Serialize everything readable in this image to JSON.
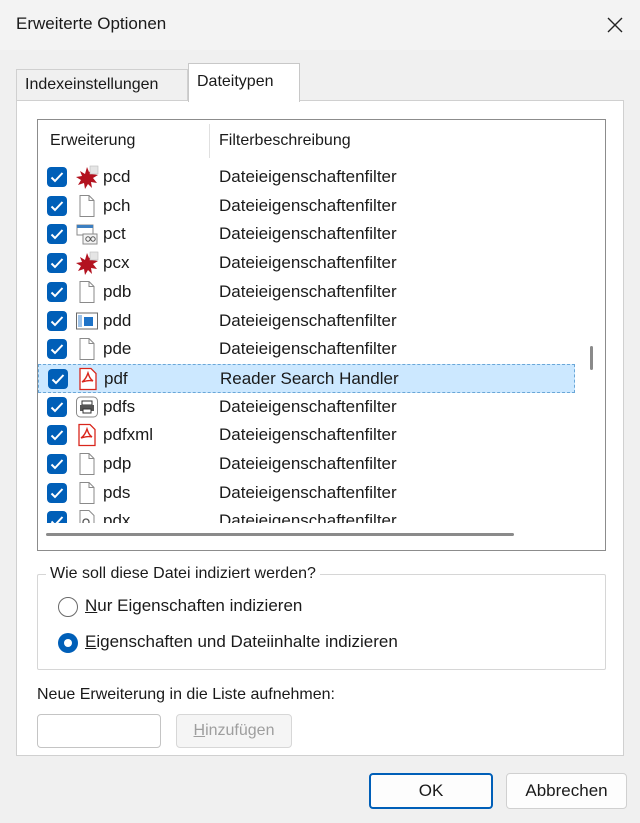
{
  "window": {
    "title": "Erweiterte Optionen"
  },
  "tabs": [
    {
      "label": "Indexeinstellungen",
      "active": false
    },
    {
      "label": "Dateitypen",
      "active": true
    }
  ],
  "list": {
    "columns": {
      "extension": "Erweiterung",
      "description": "Filterbeschreibung"
    },
    "rows": [
      {
        "ext": "pcd",
        "desc": "Dateieigenschaftenfilter",
        "icon": "paint-splash-icon",
        "checked": true
      },
      {
        "ext": "pch",
        "desc": "Dateieigenschaftenfilter",
        "icon": "blank-file-icon",
        "checked": true
      },
      {
        "ext": "pct",
        "desc": "Dateieigenschaftenfilter",
        "icon": "image-file-icon",
        "checked": true
      },
      {
        "ext": "pcx",
        "desc": "Dateieigenschaftenfilter",
        "icon": "paint-splash-icon",
        "checked": true
      },
      {
        "ext": "pdb",
        "desc": "Dateieigenschaftenfilter",
        "icon": "blank-file-icon",
        "checked": true
      },
      {
        "ext": "pdd",
        "desc": "Dateieigenschaftenfilter",
        "icon": "window-file-icon",
        "checked": true
      },
      {
        "ext": "pde",
        "desc": "Dateieigenschaftenfilter",
        "icon": "blank-file-icon",
        "checked": true
      },
      {
        "ext": "pdf",
        "desc": "Reader Search Handler",
        "icon": "pdf-file-icon",
        "checked": true,
        "selected": true
      },
      {
        "ext": "pdfs",
        "desc": "Dateieigenschaftenfilter",
        "icon": "printer-file-icon",
        "checked": true
      },
      {
        "ext": "pdfxml",
        "desc": "Dateieigenschaftenfilter",
        "icon": "pdf-file-icon",
        "checked": true
      },
      {
        "ext": "pdp",
        "desc": "Dateieigenschaftenfilter",
        "icon": "blank-file-icon",
        "checked": true
      },
      {
        "ext": "pds",
        "desc": "Dateieigenschaftenfilter",
        "icon": "blank-file-icon",
        "checked": true
      },
      {
        "ext": "pdx",
        "desc": "Dateieigenschaftenfilter",
        "icon": "search-file-icon",
        "checked": true
      }
    ]
  },
  "index_group": {
    "legend": "Wie soll diese Datei indiziert werden?",
    "options": [
      {
        "accel": "N",
        "label_rest": "ur Eigenschaften indizieren",
        "selected": false
      },
      {
        "accel": "E",
        "label_rest": "igenschaften und Dateiinhalte indizieren",
        "selected": true
      }
    ]
  },
  "new_extension": {
    "label": "Neue Erweiterung in die Liste aufnehmen:",
    "value": "",
    "add_accel": "H",
    "add_rest": "inzufügen"
  },
  "buttons": {
    "ok": "OK",
    "cancel": "Abbrechen"
  },
  "colors": {
    "accent": "#005fb8",
    "selection": "#cce8ff",
    "pdf_red": "#d9261c"
  }
}
